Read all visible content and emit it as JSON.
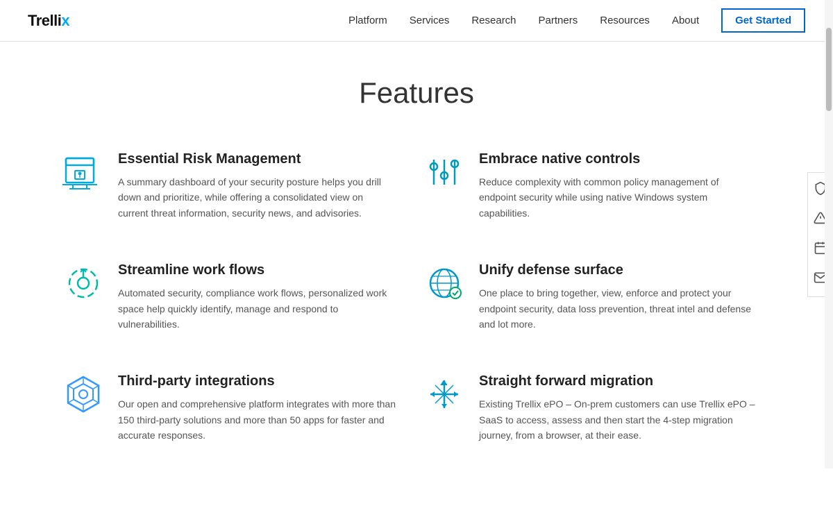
{
  "logo": {
    "text_main": "Trellix",
    "x_char": "x"
  },
  "nav": {
    "links": [
      {
        "label": "Platform",
        "href": "#"
      },
      {
        "label": "Services",
        "href": "#"
      },
      {
        "label": "Research",
        "href": "#"
      },
      {
        "label": "Partners",
        "href": "#"
      },
      {
        "label": "Resources",
        "href": "#"
      },
      {
        "label": "About",
        "href": "#"
      }
    ],
    "cta_label": "Get Started"
  },
  "page": {
    "title": "Features"
  },
  "features": [
    {
      "id": "essential-risk",
      "title": "Essential Risk Management",
      "description": "A summary dashboard of your security posture helps you drill down and prioritize, while offering a consolidated view on current threat information, security news, and advisories.",
      "icon": "lock-shield"
    },
    {
      "id": "native-controls",
      "title": "Embrace native controls",
      "description": "Reduce complexity with common policy management of endpoint security while using native Windows system capabilities.",
      "icon": "sliders"
    },
    {
      "id": "streamline-workflows",
      "title": "Streamline work flows",
      "description": "Automated security, compliance work flows, personalized work space help quickly identify, manage and respond to vulnerabilities.",
      "icon": "cycle-settings"
    },
    {
      "id": "unify-defense",
      "title": "Unify defense surface",
      "description": "One place to bring together, view, enforce and protect your endpoint security, data loss prevention, threat intel and defense and lot more.",
      "icon": "globe-shield"
    },
    {
      "id": "third-party",
      "title": "Third-party integrations",
      "description": "Our open and comprehensive platform integrates with more than 150 third-party solutions and more than 50 apps for faster and accurate responses.",
      "icon": "hexagon-network"
    },
    {
      "id": "migration",
      "title": "Straight forward migration",
      "description": "Existing Trellix ePO – On-prem customers can use Trellix ePO – SaaS to access, assess and then start the 4-step migration journey, from a browser, at their ease.",
      "icon": "arrows-cross"
    }
  ],
  "side_panel": {
    "icons": [
      "shield",
      "alert",
      "calendar",
      "envelope"
    ]
  }
}
